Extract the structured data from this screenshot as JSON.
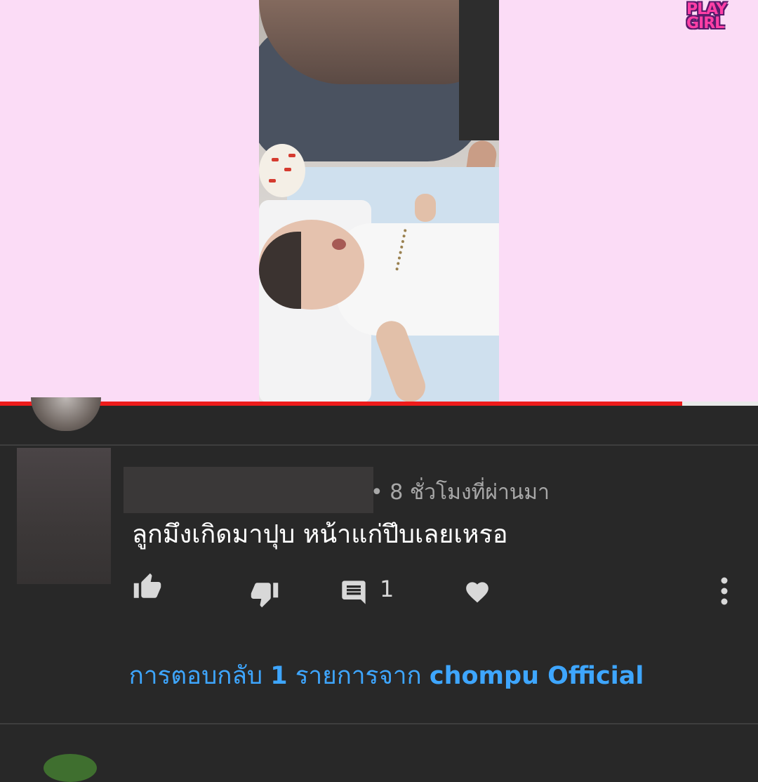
{
  "video": {
    "watermark_text": "PLAY\nGIRL",
    "progress": 0.9,
    "colors": {
      "backdrop": "#fbdcf6",
      "progress": "#ee1b1b"
    }
  },
  "comment": {
    "time_meta": "• 8 ชั่วโมงที่ผ่านมา",
    "text": "ลูกมึงเกิดมาปุบ หน้าแก่ปึบเลยเหรอ",
    "reply_count": "1",
    "actions": {
      "like_icon": "thumb-up-icon",
      "dislike_icon": "thumb-down-icon",
      "reply_icon": "comment-icon",
      "heart_icon": "heart-icon",
      "more_icon": "more-vert-icon"
    }
  },
  "replies": {
    "prefix": "การตอบกลับ ",
    "count": "1",
    "middle": " รายการจาก ",
    "author": "chompu Official",
    "color": "#3ea6ff"
  }
}
